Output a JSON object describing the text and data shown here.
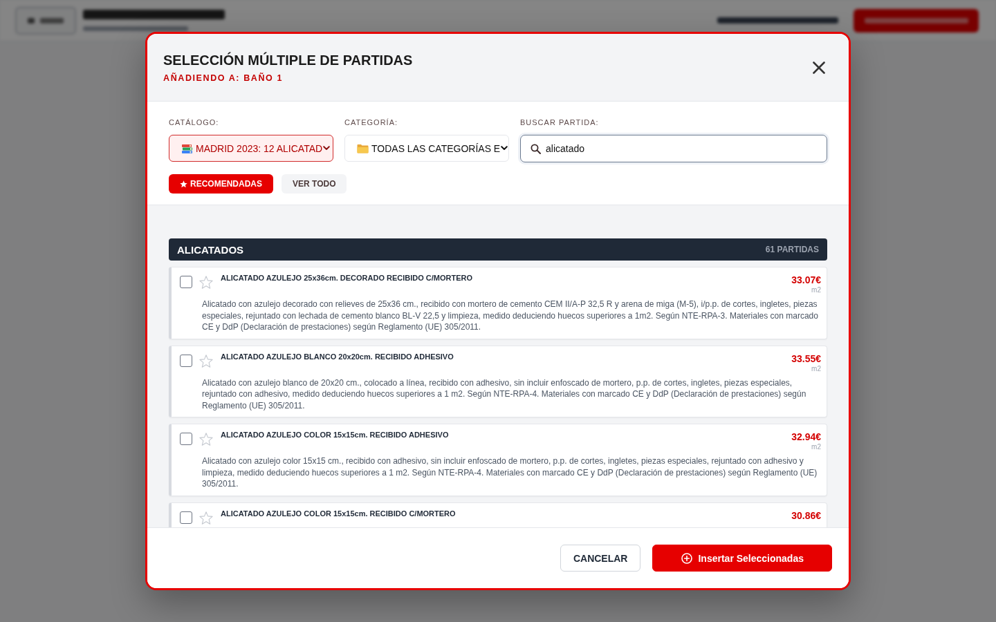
{
  "dialog": {
    "title": "SELECCIÓN MÚLTIPLE DE PARTIDAS",
    "subtitle": "AÑADIENDO A: BAÑO 1"
  },
  "filters": [
    {
      "kind": "catalog",
      "label": "CATÁLOGO:",
      "value": "MADRID 2023: 12 ALICATAD",
      "active": true
    },
    {
      "kind": "category",
      "label": "CATEGORÍA:",
      "value": "TODAS LAS CATEGORÍAS E",
      "active": false
    },
    {
      "kind": "search",
      "label": "BUSCAR PARTIDA:",
      "value": "alicatado",
      "focused": true
    }
  ],
  "view_tabs": [
    {
      "kind": "starred",
      "label": "RECOMENDADAS",
      "selected": true
    },
    {
      "kind": "plain",
      "label": "VER TODO",
      "selected": false
    }
  ],
  "group": {
    "title": "ALICATADOS",
    "count": "61 PARTIDAS"
  },
  "items": [
    {
      "title": "ALICATADO AZULEJO 25x36cm. DECORADO RECIBIDO C/MORTERO",
      "price": "33.07€",
      "unit": "m2",
      "description": "Alicatado con azulejo decorado con relieves de 25x36 cm., recibido con mortero de cemento CEM II/A-P 32,5 R y arena de miga (M-5), i/p.p. de cortes, ingletes, piezas especiales, rejuntado con lechada de cemento blanco BL-V 22,5 y limpieza, medido deduciendo huecos superiores a 1m2. Según NTE-RPA-3. Materiales con marcado CE y DdP (Declaración de prestaciones) según Reglamento (UE) 305/2011.",
      "checked": false,
      "favorite": false
    },
    {
      "title": "ALICATADO AZULEJO BLANCO 20x20cm. RECIBIDO ADHESIVO",
      "price": "33.55€",
      "unit": "m2",
      "description": "Alicatado con azulejo blanco de 20x20 cm., colocado a línea, recibido con adhesivo, sin incluir enfoscado de mortero, p.p. de cortes, ingletes, piezas especiales, rejuntado con adhesivo, medido deduciendo huecos superiores a 1 m2. Según NTE-RPA-4. Materiales con marcado CE y DdP (Declaración de prestaciones) según Reglamento (UE) 305/2011.",
      "checked": false,
      "favorite": false
    },
    {
      "title": "ALICATADO AZULEJO COLOR 15x15cm. RECIBIDO ADHESIVO",
      "price": "32.94€",
      "unit": "m2",
      "description": "Alicatado con azulejo color 15x15 cm., recibido con adhesivo, sin incluir enfoscado de mortero, p.p. de cortes, ingletes, piezas especiales, rejuntado con adhesivo y limpieza, medido deduciendo huecos superiores a 1 m2. Según NTE-RPA-4. Materiales con marcado CE y DdP (Declaración de prestaciones) según Reglamento (UE) 305/2011.",
      "checked": false,
      "favorite": false
    },
    {
      "title": "ALICATADO AZULEJO COLOR 15x15cm. RECIBIDO C/MORTERO",
      "price": "30.86€",
      "checked": false,
      "favorite": false
    }
  ],
  "footer_buttons": [
    {
      "kind": "secondary",
      "label": "CANCELAR"
    },
    {
      "kind": "primary",
      "label": "Insertar Seleccionadas"
    }
  ]
}
